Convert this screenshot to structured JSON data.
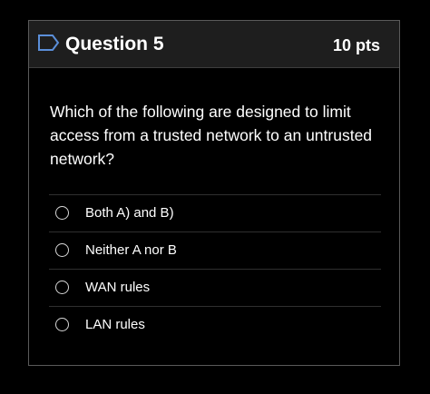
{
  "header": {
    "title": "Question 5",
    "points": "10 pts",
    "flag_icon": "bookmark-flag-icon"
  },
  "question": {
    "text": "Which of the following are designed to limit access from a trusted network to an untrusted network?"
  },
  "answers": [
    {
      "label": "Both A) and B)",
      "selected": false
    },
    {
      "label": "Neither A nor B",
      "selected": false
    },
    {
      "label": "WAN rules",
      "selected": false
    },
    {
      "label": "LAN rules",
      "selected": false
    }
  ],
  "colors": {
    "background": "#000000",
    "header_background": "#1e1e1e",
    "border": "#5a5a5a",
    "text": "#ffffff",
    "flag": "#5b8fd9"
  }
}
